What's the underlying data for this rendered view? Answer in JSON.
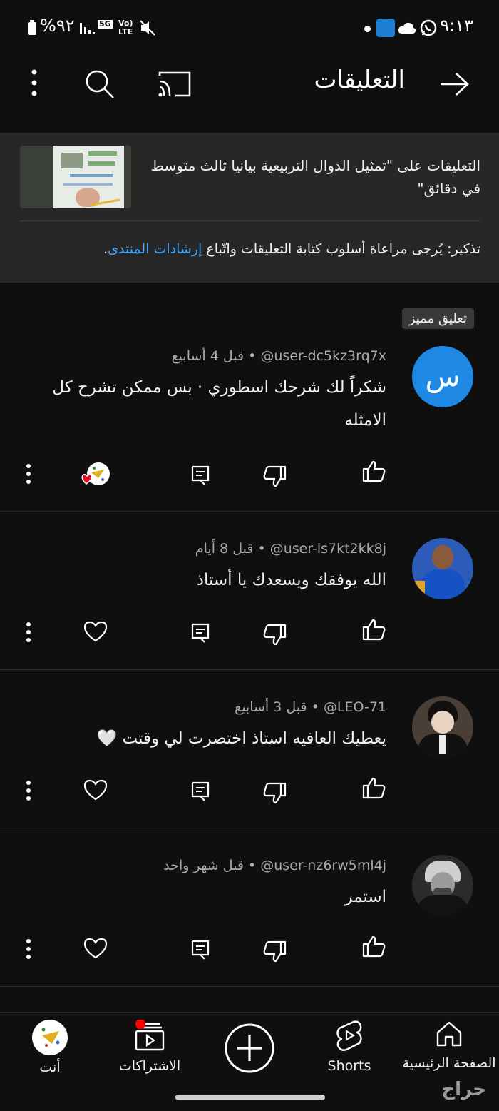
{
  "status_bar": {
    "time": "٩:١٣",
    "battery": "%٩٢",
    "network_5g": "5G",
    "volte_top": "Vo)",
    "volte_bottom": "LTE"
  },
  "header": {
    "title": "التعليقات"
  },
  "video_panel": {
    "title": "التعليقات على \"تمثيل الدوال التربيعية بيانيا ثالث متوسط في دقائق\"",
    "reminder_prefix": "تذكير: يُرجى مراعاة أسلوب كتابة التعليقات واتّباع ",
    "reminder_link": "إرشادات المنتدى",
    "reminder_suffix": "."
  },
  "pinned_label": "تعليق مميز",
  "comments": [
    {
      "avatar_text": "س",
      "handle": "@user-dc5kz3rq7x",
      "time": "قبل 4 أسابيع",
      "text": "شكراً لك شرحك اسطوري · بس ممكن تشرح كل الامثله"
    },
    {
      "handle": "@user-ls7kt2kk8j",
      "time": "قبل 8 أيام",
      "text": "الله يوفقك ويسعدك يا أستاذ"
    },
    {
      "handle": "@LEO-71",
      "time": "قبل 3 أسابيع",
      "text": "يعطيك العافيه استاذ اختصرت لي وقتت 🤍"
    },
    {
      "handle": "@user-nz6rw5ml4j",
      "time": "قبل شهر واحد",
      "text": "استمر"
    }
  ],
  "bottom_nav": {
    "home": "الصفحة الرئيسية",
    "shorts": "Shorts",
    "subscriptions": "الاشتراكات",
    "you": "أنت"
  },
  "watermark": "حراج",
  "colors": {
    "background": "#0f0f0f",
    "panel": "#272727",
    "link": "#3ea6ff",
    "avatar_blue": "#1e88e5",
    "notification": "#ff0000"
  }
}
